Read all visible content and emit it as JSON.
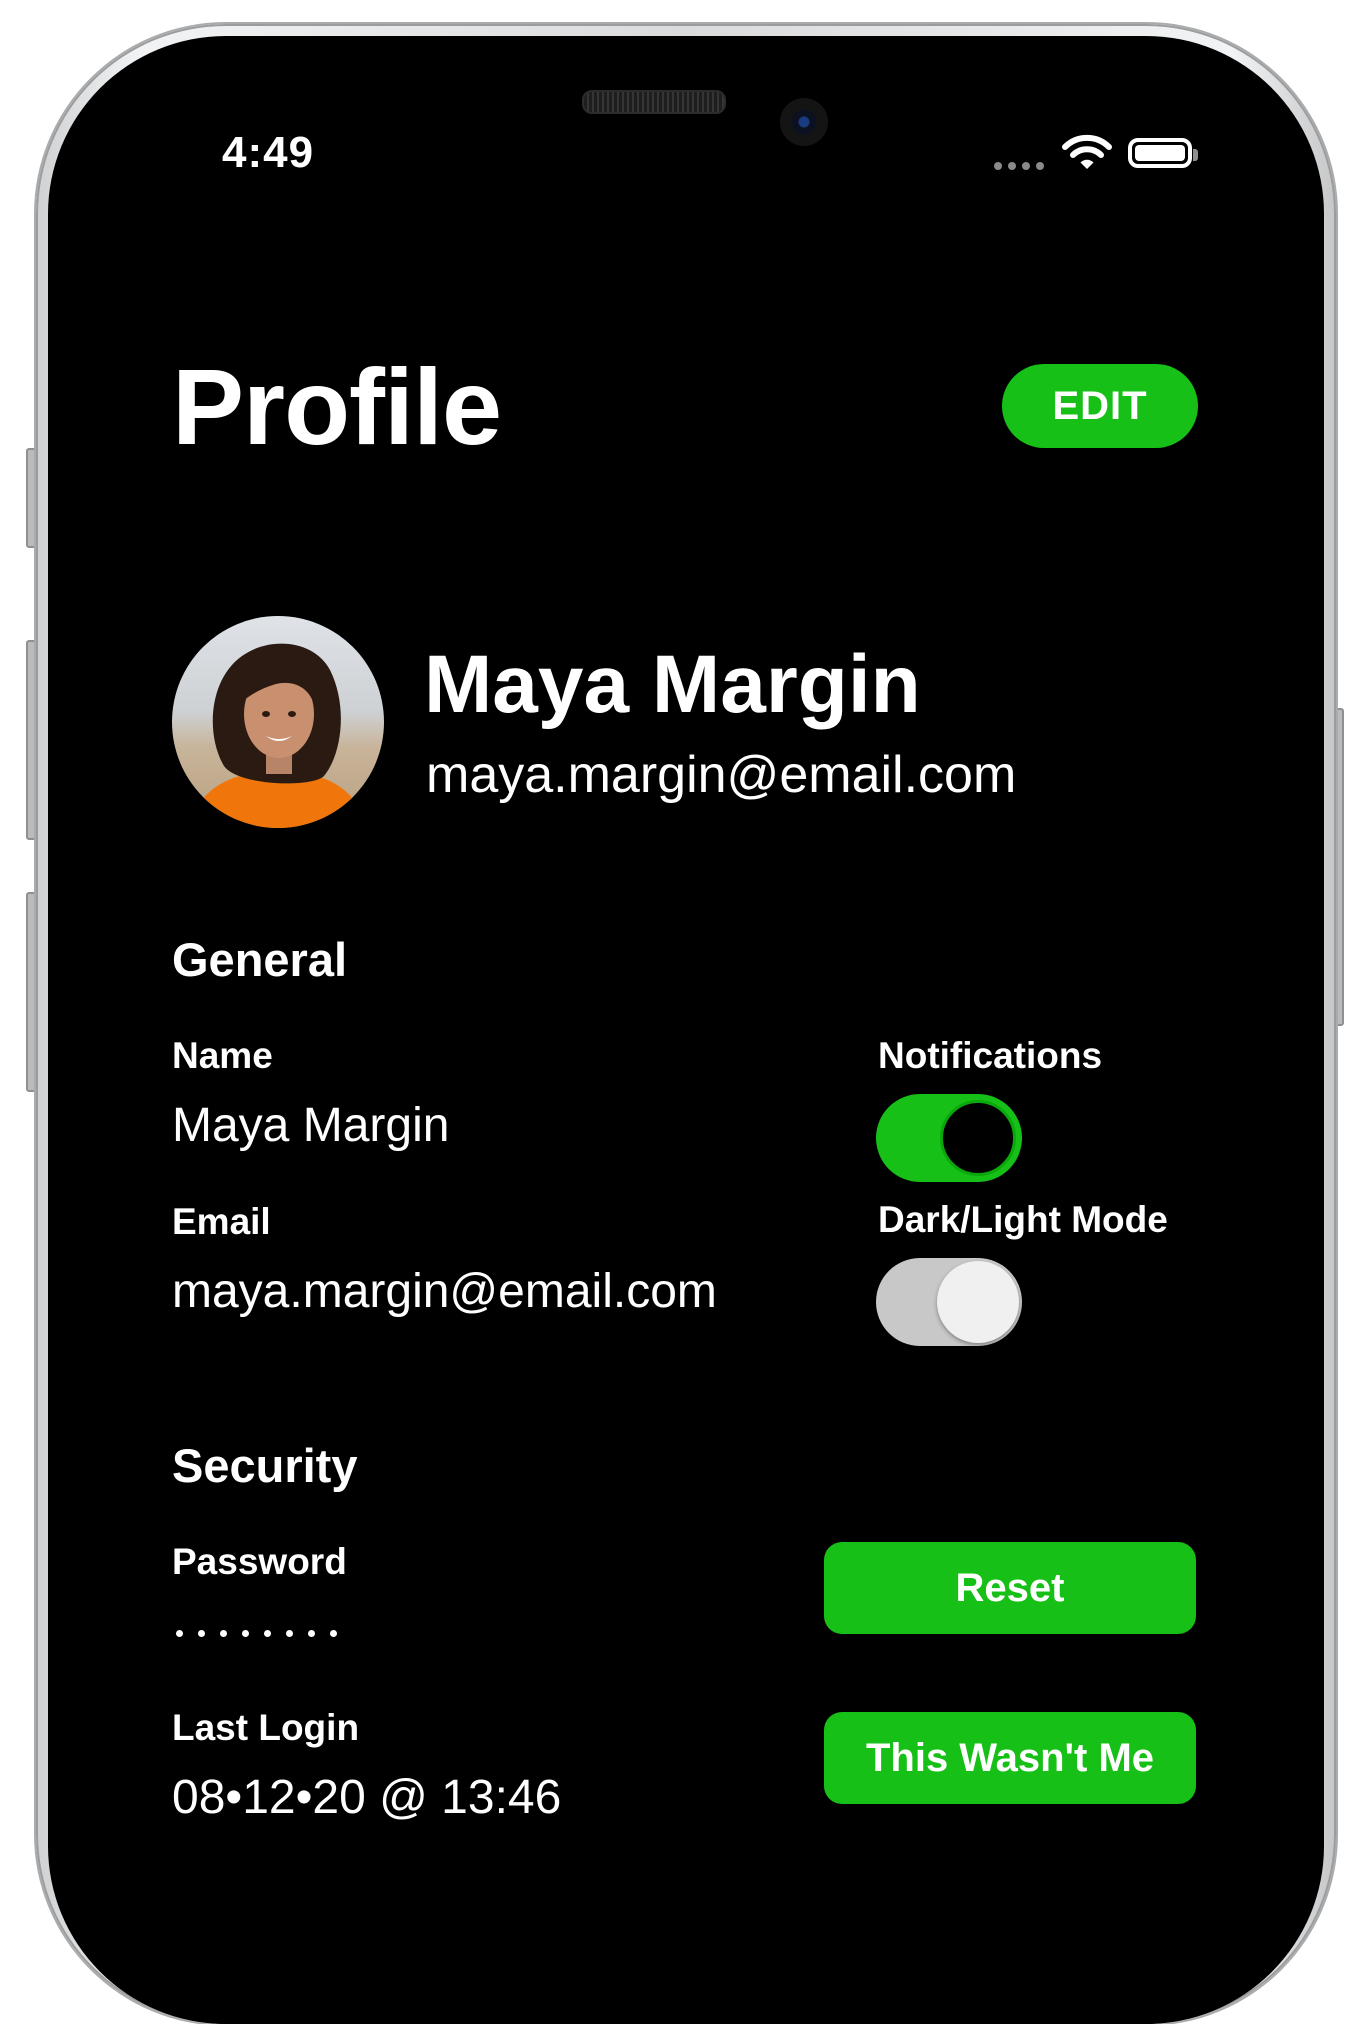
{
  "status_bar": {
    "time": "4:49"
  },
  "header": {
    "title": "Profile",
    "edit_label": "EDIT"
  },
  "profile": {
    "name": "Maya Margin",
    "email": "maya.margin@email.com"
  },
  "general": {
    "title": "General",
    "name_label": "Name",
    "name_value": "Maya Margin",
    "email_label": "Email",
    "email_value": "maya.margin@email.com",
    "notifications_label": "Notifications",
    "notifications_on": true,
    "mode_label": "Dark/Light Mode",
    "mode_on": false
  },
  "security": {
    "title": "Security",
    "password_label": "Password",
    "password_mask": "••••••••",
    "reset_label": "Reset",
    "last_login_label": "Last Login",
    "last_login_value": "08•12•20 @ 13:46",
    "not_me_label": "This Wasn't Me"
  },
  "colors": {
    "accent": "#17c017",
    "background": "#000000",
    "text": "#ffffff"
  }
}
